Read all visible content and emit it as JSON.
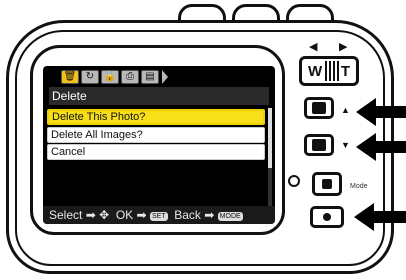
{
  "screen": {
    "tabs": [
      {
        "icon": "trash-icon",
        "glyph": "🗑",
        "active": true
      },
      {
        "icon": "rotate-icon",
        "glyph": "↻",
        "active": false
      },
      {
        "icon": "lock-icon",
        "glyph": "🔒",
        "active": false
      },
      {
        "icon": "print-icon",
        "glyph": "⎙",
        "active": false
      },
      {
        "icon": "slideshow-icon",
        "glyph": "▤",
        "active": false
      }
    ],
    "menu_title": "Delete",
    "items": [
      {
        "label": "Delete This Photo?",
        "selected": true
      },
      {
        "label": "Delete All Images?",
        "selected": false
      },
      {
        "label": "Cancel",
        "selected": false
      }
    ],
    "hint": {
      "select": "Select",
      "select_arrow": "➡",
      "ok": "OK",
      "ok_arrow": "➡",
      "set_btn": "SET",
      "back": "Back",
      "back_arrow": "➡",
      "mode_btn": "MODE"
    }
  },
  "controls": {
    "zoom_w": "W",
    "zoom_t": "T",
    "zoom_left_arrow": "◀",
    "zoom_right_arrow": "▶",
    "up_triangle": "▲",
    "down_triangle": "▼",
    "mode_label": "Mode"
  },
  "colors": {
    "selected_item": "#f7e01a",
    "active_tab": "#f2c21b",
    "screen_bg": "#000000"
  }
}
